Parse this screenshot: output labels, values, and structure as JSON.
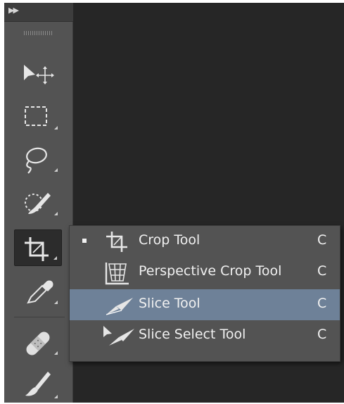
{
  "toolbar": {
    "collapse_icon": "double-chevron-right-icon",
    "tools": [
      {
        "name": "move-tool",
        "icon": "move-icon"
      },
      {
        "name": "rectangular-marquee-tool",
        "icon": "marquee-icon"
      },
      {
        "name": "lasso-tool",
        "icon": "lasso-icon"
      },
      {
        "name": "quick-selection-tool",
        "icon": "quick-selection-icon"
      },
      {
        "name": "crop-tool",
        "icon": "crop-icon",
        "active": true
      },
      {
        "name": "eyedropper-tool",
        "icon": "eyedropper-icon"
      },
      {
        "name": "healing-brush-tool",
        "icon": "bandage-icon"
      },
      {
        "name": "brush-tool",
        "icon": "brush-icon"
      }
    ]
  },
  "flyout": {
    "items": [
      {
        "label": "Crop Tool",
        "shortcut": "C",
        "selected": true,
        "icon": "crop-icon"
      },
      {
        "label": "Perspective Crop Tool",
        "shortcut": "C",
        "selected": false,
        "icon": "perspective-crop-icon"
      },
      {
        "label": "Slice Tool",
        "shortcut": "C",
        "selected": false,
        "highlighted": true,
        "icon": "slice-icon"
      },
      {
        "label": "Slice Select Tool",
        "shortcut": "C",
        "selected": false,
        "icon": "slice-select-icon"
      }
    ]
  },
  "colors": {
    "panel": "#535353",
    "canvas": "#262626",
    "highlight": "#6e8198",
    "text": "#f0f0f0"
  }
}
